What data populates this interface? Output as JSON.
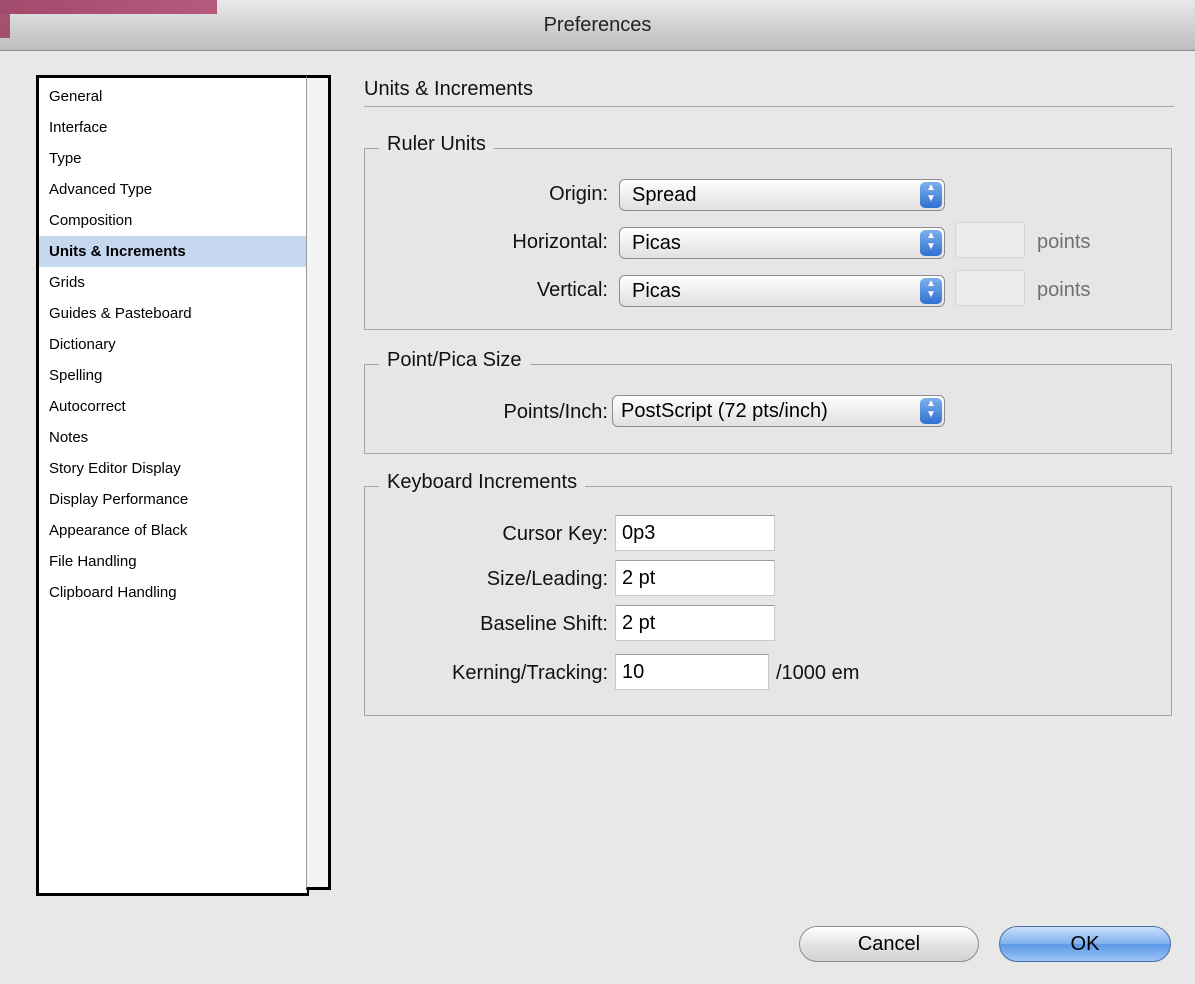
{
  "window": {
    "title": "Preferences"
  },
  "sidebar": {
    "items": [
      {
        "label": "General"
      },
      {
        "label": "Interface"
      },
      {
        "label": "Type"
      },
      {
        "label": "Advanced Type"
      },
      {
        "label": "Composition"
      },
      {
        "label": "Units & Increments",
        "selected": true
      },
      {
        "label": "Grids"
      },
      {
        "label": "Guides & Pasteboard"
      },
      {
        "label": "Dictionary"
      },
      {
        "label": "Spelling"
      },
      {
        "label": "Autocorrect"
      },
      {
        "label": "Notes"
      },
      {
        "label": "Story Editor Display"
      },
      {
        "label": "Display Performance"
      },
      {
        "label": "Appearance of Black"
      },
      {
        "label": "File Handling"
      },
      {
        "label": "Clipboard Handling"
      }
    ]
  },
  "main": {
    "section_title": "Units & Increments",
    "ruler_units": {
      "legend": "Ruler Units",
      "origin_label": "Origin:",
      "origin_value": "Spread",
      "horizontal_label": "Horizontal:",
      "horizontal_value": "Picas",
      "horizontal_points_value": "",
      "vertical_label": "Vertical:",
      "vertical_value": "Picas",
      "vertical_points_value": "",
      "points_unit": "points"
    },
    "point_pica_size": {
      "legend": "Point/Pica Size",
      "points_inch_label": "Points/Inch:",
      "points_inch_value": "PostScript (72 pts/inch)"
    },
    "keyboard_increments": {
      "legend": "Keyboard Increments",
      "cursor_key_label": "Cursor Key:",
      "cursor_key_value": "0p3",
      "size_leading_label": "Size/Leading:",
      "size_leading_value": "2 pt",
      "baseline_shift_label": "Baseline Shift:",
      "baseline_shift_value": "2 pt",
      "kerning_label": "Kerning/Tracking:",
      "kerning_value": "10",
      "kerning_unit": "/1000 em"
    }
  },
  "buttons": {
    "cancel": "Cancel",
    "ok": "OK"
  },
  "colors": {
    "selection": "#c5d8f0",
    "accent_blue": "#5c98e8",
    "titlebar_accent": "#9a3a5e"
  }
}
